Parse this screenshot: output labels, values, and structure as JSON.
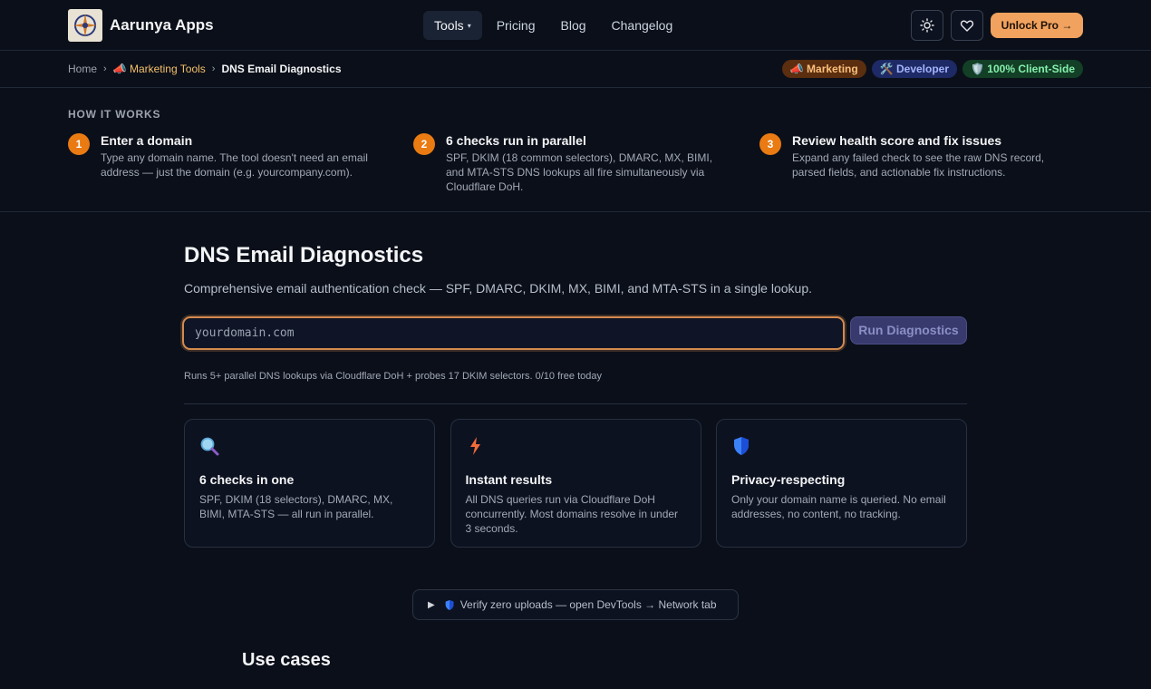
{
  "brand": {
    "name": "Aarunya Apps"
  },
  "nav": {
    "items": [
      {
        "label": "Tools",
        "active": true,
        "caret": "▾"
      },
      {
        "label": "Pricing"
      },
      {
        "label": "Blog"
      },
      {
        "label": "Changelog"
      }
    ],
    "unlock_pro": "Unlock Pro →"
  },
  "breadcrumb": {
    "home": "Home",
    "section": "📣 Marketing Tools",
    "current": "DNS Email Diagnostics",
    "separator": "›"
  },
  "badges": [
    {
      "label": "📣 Marketing"
    },
    {
      "label": "🛠️ Developer"
    },
    {
      "label": "🛡️ 100% Client-Side"
    }
  ],
  "how_it_works": {
    "title": "HOW IT WORKS",
    "steps": [
      {
        "num": "1",
        "title": "Enter a domain",
        "desc": "Type any domain name. The tool doesn't need an email address — just the domain (e.g. yourcompany.com)."
      },
      {
        "num": "2",
        "title": "6 checks run in parallel",
        "desc": "SPF, DKIM (18 common selectors), DMARC, MX, BIMI, and MTA-STS DNS lookups all fire simultaneously via Cloudflare DoH."
      },
      {
        "num": "3",
        "title": "Review health score and fix issues",
        "desc": "Expand any failed check to see the raw DNS record, parsed fields, and actionable fix instructions."
      }
    ]
  },
  "main": {
    "title": "DNS Email Diagnostics",
    "subtitle": "Comprehensive email authentication check — SPF, DMARC, DKIM, MX, BIMI, and MTA-STS in a single lookup.",
    "input_placeholder": "yourdomain.com",
    "input_value": "",
    "run_button": "Run Diagnostics",
    "hint": "Runs 5+ parallel DNS lookups via Cloudflare DoH + probes 17 DKIM selectors. 0/10 free today"
  },
  "features": [
    {
      "icon": "magnifier-icon",
      "glyph": "🔍",
      "title": "6 checks in one",
      "desc": "SPF, DKIM (18 selectors), DMARC, MX, BIMI, MTA-STS — all run in parallel."
    },
    {
      "icon": "lightning-icon",
      "glyph": "⚡",
      "title": "Instant results",
      "desc": "All DNS queries run via Cloudflare DoH concurrently. Most domains resolve in under 3 seconds."
    },
    {
      "icon": "shield-icon",
      "glyph": "🛡️",
      "title": "Privacy-respecting",
      "desc": "Only your domain name is queried. No email addresses, no content, no tracking."
    }
  ],
  "verify": {
    "label": "Verify zero uploads — open DevTools → Network tab",
    "toggle": "▶"
  },
  "use_cases": {
    "title": "Use cases"
  },
  "colors": {
    "accent": "#ea7a12",
    "pro": "#f0a25e",
    "bg": "#0b0f19"
  }
}
